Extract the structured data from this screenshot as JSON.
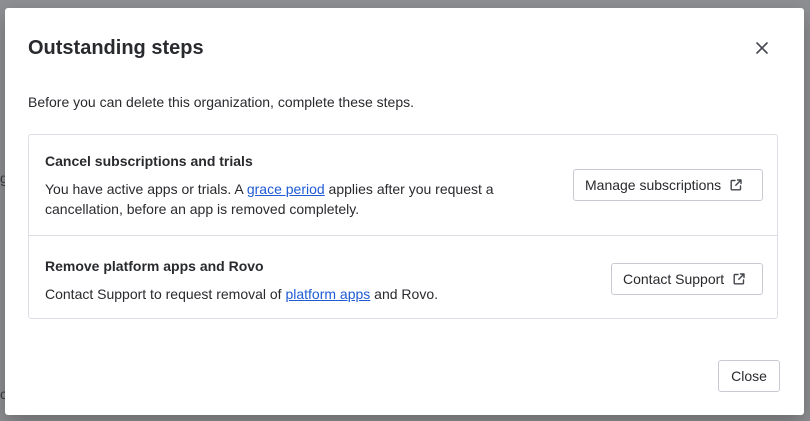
{
  "background": {
    "fragment_1": "g",
    "fragment_2": "c"
  },
  "dialog": {
    "title": "Outstanding steps",
    "close_icon": "close-icon",
    "intro": "Before you can delete this organization, complete these steps.",
    "steps": [
      {
        "title": "Cancel subscriptions and trials",
        "desc_before": "You have active apps or trials. A ",
        "link": "grace period",
        "desc_after": " applies after you request a cancellation, before an app is removed completely.",
        "button": "Manage subscriptions",
        "button_icon": "external-link-icon"
      },
      {
        "title": "Remove platform apps and Rovo",
        "desc_before": "Contact Support to request removal of ",
        "link": "platform apps",
        "desc_after": " and Rovo.",
        "button": "Contact Support",
        "button_icon": "external-link-icon"
      }
    ],
    "footer_button": "Close"
  },
  "colors": {
    "link": "#1f5bd4",
    "text": "#292a2e",
    "border": "#dcdfe4",
    "backdrop": "#8e8f92"
  }
}
